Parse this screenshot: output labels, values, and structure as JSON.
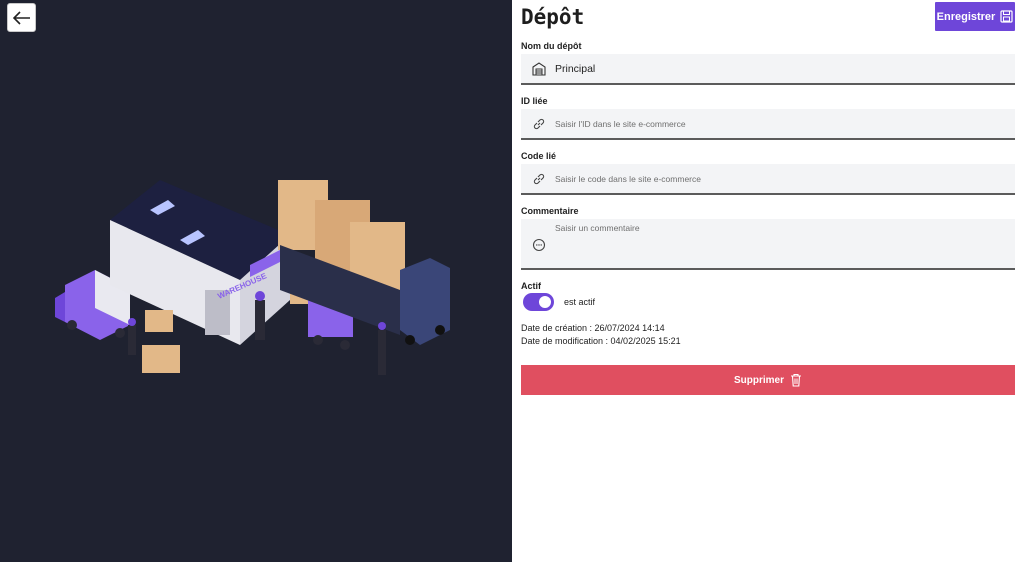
{
  "header": {
    "title": "Dépôt",
    "save_label": "Enregistrer"
  },
  "form": {
    "name": {
      "label": "Nom du dépôt",
      "value": "Principal"
    },
    "linked_id": {
      "label": "ID liée",
      "placeholder": "Saisir l'ID dans le site e-commerce"
    },
    "linked_code": {
      "label": "Code lié",
      "placeholder": "Saisir le code dans le site e-commerce"
    },
    "comment": {
      "label": "Commentaire",
      "placeholder": "Saisir un commentaire"
    },
    "active": {
      "label": "Actif",
      "toggle_label": "est actif",
      "value": true
    }
  },
  "meta": {
    "created": "Date de création : 26/07/2024 14:14",
    "modified": "Date de modification : 04/02/2025 15:21"
  },
  "actions": {
    "delete_label": "Supprimer"
  },
  "illustration": {
    "sign_text": "WAREHOUSE"
  },
  "icons": {
    "back": "arrow-left-icon",
    "save": "floppy-disk-icon",
    "warehouse": "warehouse-icon",
    "link": "link-icon",
    "comment": "chat-bubble-icon",
    "delete": "trash-icon"
  },
  "colors": {
    "left_bg": "#1f2230",
    "accent": "#6e46d9",
    "danger": "#e04f60",
    "field_bg": "#f3f4f6"
  }
}
